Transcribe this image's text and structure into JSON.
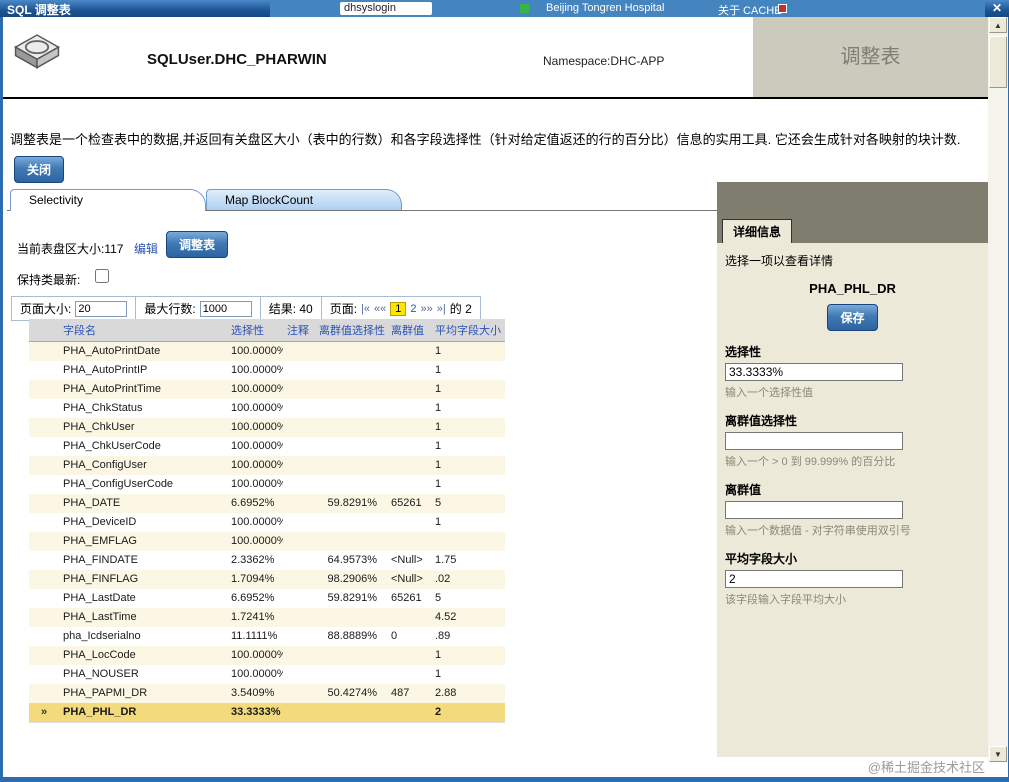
{
  "titlebar": {
    "title": "SQL 调整表",
    "close_icon": "✕"
  },
  "background_page": {
    "login_text": "dhsyslogin",
    "hospital_text": "Beijing Tongren Hospital",
    "about_text": "关于 CACHE"
  },
  "header": {
    "table_title": "SQLUser.DHC_PHARWIN",
    "namespace": "Namespace:DHC-APP",
    "page_type": "调整表"
  },
  "intro": {
    "description": "调整表是一个检查表中的数据,并返回有关盘区大小（表中的行数）和各字段选择性（针对给定值返还的行的百分比）信息的实用工具. 它还会生成针对各映射的块计数.",
    "close_button": "关闭"
  },
  "tabs": {
    "selectivity": "Selectivity",
    "map_blockcount": "Map BlockCount"
  },
  "toolbar": {
    "extent_size": "当前表盘区大小:117",
    "edit_link": "编辑",
    "tune_button": "调整表",
    "keep_class_label": "保持类最新:"
  },
  "pager": {
    "page_size_label": "页面大小:",
    "page_size_value": "20",
    "max_rows_label": "最大行数:",
    "max_rows_value": "1000",
    "results_label": "结果: 40",
    "page_label": "页面:",
    "first": "|«",
    "prev": "««",
    "page1": "1",
    "page2": "2",
    "next": "»»",
    "last": "»|",
    "of_label": "的 2"
  },
  "table": {
    "headers": [
      "字段名",
      "选择性",
      "注释",
      "离群值选择性",
      "离群值",
      "平均字段大小"
    ],
    "rows": [
      {
        "selected": false,
        "name": "PHA_AutoPrintDate",
        "selectivity": "100.0000%",
        "notes": "",
        "outlier_selectivity": "",
        "outlier": "",
        "avg": "1"
      },
      {
        "selected": false,
        "name": "PHA_AutoPrintIP",
        "selectivity": "100.0000%",
        "notes": "",
        "outlier_selectivity": "",
        "outlier": "",
        "avg": "1"
      },
      {
        "selected": false,
        "name": "PHA_AutoPrintTime",
        "selectivity": "100.0000%",
        "notes": "",
        "outlier_selectivity": "",
        "outlier": "",
        "avg": "1"
      },
      {
        "selected": false,
        "name": "PHA_ChkStatus",
        "selectivity": "100.0000%",
        "notes": "",
        "outlier_selectivity": "",
        "outlier": "",
        "avg": "1"
      },
      {
        "selected": false,
        "name": "PHA_ChkUser",
        "selectivity": "100.0000%",
        "notes": "",
        "outlier_selectivity": "",
        "outlier": "",
        "avg": "1"
      },
      {
        "selected": false,
        "name": "PHA_ChkUserCode",
        "selectivity": "100.0000%",
        "notes": "",
        "outlier_selectivity": "",
        "outlier": "",
        "avg": "1"
      },
      {
        "selected": false,
        "name": "PHA_ConfigUser",
        "selectivity": "100.0000%",
        "notes": "",
        "outlier_selectivity": "",
        "outlier": "",
        "avg": "1"
      },
      {
        "selected": false,
        "name": "PHA_ConfigUserCode",
        "selectivity": "100.0000%",
        "notes": "",
        "outlier_selectivity": "",
        "outlier": "",
        "avg": "1"
      },
      {
        "selected": false,
        "name": "PHA_DATE",
        "selectivity": "6.6952%",
        "notes": "",
        "outlier_selectivity": "59.8291%",
        "outlier": "65261",
        "avg": "5"
      },
      {
        "selected": false,
        "name": "PHA_DeviceID",
        "selectivity": "100.0000%",
        "notes": "",
        "outlier_selectivity": "",
        "outlier": "",
        "avg": "1"
      },
      {
        "selected": false,
        "name": "PHA_EMFLAG",
        "selectivity": "100.0000%",
        "notes": "",
        "outlier_selectivity": "",
        "outlier": "",
        "avg": ""
      },
      {
        "selected": false,
        "name": "PHA_FINDATE",
        "selectivity": "2.3362%",
        "notes": "",
        "outlier_selectivity": "64.9573%",
        "outlier": "<Null>",
        "avg": "1.75"
      },
      {
        "selected": false,
        "name": "PHA_FINFLAG",
        "selectivity": "1.7094%",
        "notes": "",
        "outlier_selectivity": "98.2906%",
        "outlier": "<Null>",
        "avg": ".02"
      },
      {
        "selected": false,
        "name": "PHA_LastDate",
        "selectivity": "6.6952%",
        "notes": "",
        "outlier_selectivity": "59.8291%",
        "outlier": "65261",
        "avg": "5"
      },
      {
        "selected": false,
        "name": "PHA_LastTime",
        "selectivity": "1.7241%",
        "notes": "",
        "outlier_selectivity": "",
        "outlier": "",
        "avg": "4.52"
      },
      {
        "selected": false,
        "name": "pha_Icdserialno",
        "selectivity": "11.1111%",
        "notes": "",
        "outlier_selectivity": "88.8889%",
        "outlier": "0",
        "avg": ".89"
      },
      {
        "selected": false,
        "name": "PHA_LocCode",
        "selectivity": "100.0000%",
        "notes": "",
        "outlier_selectivity": "",
        "outlier": "",
        "avg": "1"
      },
      {
        "selected": false,
        "name": "PHA_NOUSER",
        "selectivity": "100.0000%",
        "notes": "",
        "outlier_selectivity": "",
        "outlier": "",
        "avg": "1"
      },
      {
        "selected": false,
        "name": "PHA_PAPMI_DR",
        "selectivity": "3.5409%",
        "notes": "",
        "outlier_selectivity": "50.4274%",
        "outlier": "487",
        "avg": "2.88"
      },
      {
        "selected": true,
        "name": "PHA_PHL_DR",
        "selectivity": "33.3333%",
        "notes": "",
        "outlier_selectivity": "",
        "outlier": "",
        "avg": "2"
      }
    ]
  },
  "detail": {
    "tab": "详细信息",
    "hint_top": "选择一项以查看详情",
    "field_title": "PHA_PHL_DR",
    "save_button": "保存",
    "fields": [
      {
        "label": "选择性",
        "value": "33.3333%",
        "hint": "输入一个选择性值"
      },
      {
        "label": "离群值选择性",
        "value": "",
        "hint": "输入一个 > 0 到 99.999% 的百分比"
      },
      {
        "label": "离群值",
        "value": "",
        "hint": "输入一个数据值 - 对字符串使用双引号"
      },
      {
        "label": "平均字段大小",
        "value": "2",
        "hint": "该字段输入字段平均大小"
      }
    ]
  },
  "watermark": "@稀土掘金技术社区"
}
